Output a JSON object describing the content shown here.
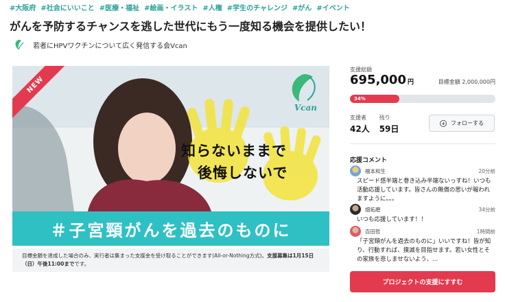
{
  "tags": [
    "#大阪府",
    "#社会にいいこと",
    "#医療・福祉",
    "#絵画・イラスト",
    "#人権",
    "#学生のチャレンジ",
    "#がん",
    "#イベント"
  ],
  "title": "がんを予防するチャンスを逃した世代にもう一度知る機会を提供したい！",
  "owner": {
    "name": "若者にHPVワクチンについて広く発信する会Vcan"
  },
  "hero": {
    "badge": "NEW",
    "logo_text": "Vcan",
    "copy_line1": "知らないままで",
    "copy_line2": "後悔しないで",
    "hashtag": "＃子宮頸がんを過去のものに"
  },
  "notice": {
    "text_before": "目標金額を達成した場合のみ、実行者は集まった支援金を受け取ることができます(All-or-Nothing方式)。",
    "text_bold": "支援募集は1月15日（日）午後11:00まで",
    "text_after": "です。"
  },
  "funding": {
    "raised_label": "支援総額",
    "raised_amount": "695,000",
    "raised_unit": "円",
    "goal_text": "目標金額 2,000,000円",
    "percent_text": "34%",
    "percent_value": 0.34
  },
  "stats": {
    "supporters_label": "支援者",
    "supporters_value": "42人",
    "remaining_label": "残り",
    "remaining_value": "59日"
  },
  "follow_button": "フォローする",
  "comments": {
    "heading": "応援コメント",
    "items": [
      {
        "name": "福本和生",
        "time": "20分前",
        "body": "スピード感半端と巻き込み半端ないっすね！いつも活動応援しています。皆さんの無償の思いが報われますように。。。"
      },
      {
        "name": "畑拓磨",
        "time": "34分前",
        "body": "いつも応援しています！！"
      },
      {
        "name": "百田哲",
        "time": "1時間前",
        "body": "「子宮頸がんを過去のものに」いいですね！皆が知り、行動すれば、撲滅を目指せます。若い女性とその家族を悲しませないよう、..."
      }
    ]
  },
  "support_button": "プロジェクトの支援にすすむ",
  "colors": {
    "accent": "#e33a4f",
    "tag": "#2aa197",
    "hashbar": "#2fc0c4"
  }
}
